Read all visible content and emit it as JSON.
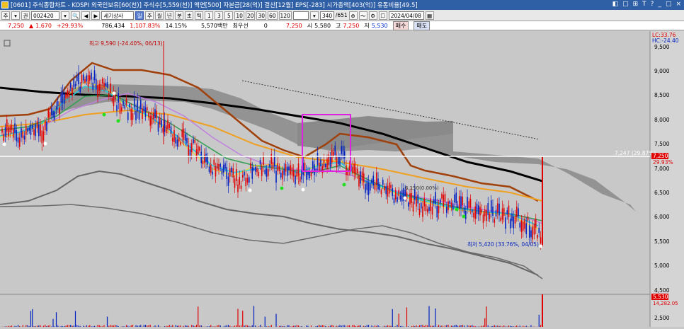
{
  "window": {
    "title": "[0601] 주식종합차트 - KOSPI 외국인보유[60(천)] 주식수[5,559(천)] 액면[500] 자본금[28(억)] 결산[12월] EPS[-283] 시가총액[403(억)] 유통비율[49.5]",
    "buttons": [
      "◧",
      "□",
      "⊞",
      "T",
      "?",
      "_",
      "□",
      "×"
    ]
  },
  "toolbar": {
    "mode1": "주",
    "mode2": "권",
    "code": "002420",
    "name": "세기상사",
    "periods": [
      "일",
      "주",
      "월",
      "년",
      "분",
      "초",
      "틱"
    ],
    "selected_period": "일",
    "intervals": [
      "1",
      "3",
      "5",
      "10",
      "20",
      "30",
      "60",
      "120"
    ],
    "count": "340",
    "count_total": "/651",
    "date": "2024/04/08"
  },
  "priceline": {
    "price": "7,250",
    "change": "1,670",
    "change_pct": "+29.93%",
    "volume": "786,434",
    "volume_pct": "1,107.83%",
    "turnover": "14.15%",
    "amount": "5,570백만",
    "preferred_label": "최우선",
    "preferred_value": "0",
    "last": "7,250",
    "open_label": "시",
    "open": "5,580",
    "high_label": "고",
    "high": "7,250",
    "low_label": "저",
    "low": "5,530",
    "buy_label": "매수",
    "sell_label": "매도"
  },
  "chart": {
    "lc_label": "LC:33.76",
    "hc_label": "HC:-24.40",
    "high_annotation": "최고 9,590 (-24.40%, 06/13)",
    "low_annotation": "최저 5,420 (33.76%, 04/05)",
    "mid_annotation": "6,150(0.00%)",
    "ref_line_label": "7,247 (29.87%)",
    "current_price_tag": "7,250",
    "current_pct_tag": "29.93%",
    "volume_tag": "5,530",
    "volume_value_tag": "14,282.05",
    "price_axis": [
      "9,500",
      "9,000",
      "8,500",
      "8,000",
      "7,500",
      "7,000",
      "6,500",
      "6,000",
      "5,500",
      "5,000",
      "4,500"
    ],
    "volume_axis": [
      "2,500"
    ],
    "colors": {
      "up": "#e00000",
      "down": "#0020c0",
      "ma_long": "#000000",
      "ma_brown": "#a0400a",
      "ma_orange": "#f0a020",
      "ma_green": "#30a050",
      "ma_violet": "#c080e0",
      "ma_cyan": "#20d0e0",
      "ma_yellow": "#f0e020",
      "cloud": "#8a8a8a",
      "highlight": "#e020e0"
    }
  }
}
